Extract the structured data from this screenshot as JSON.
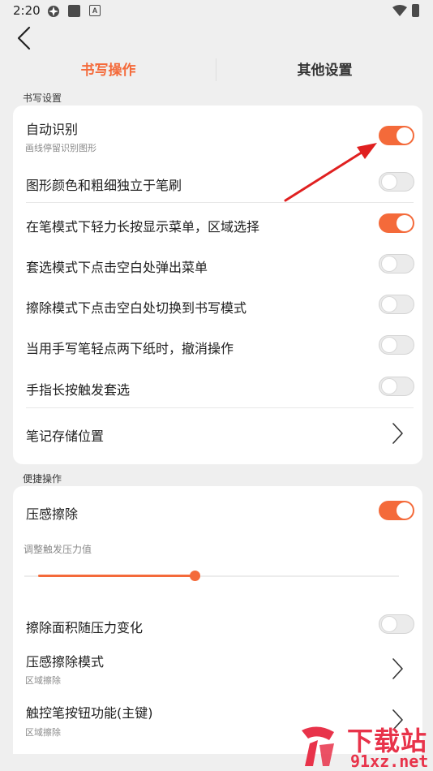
{
  "status_bar": {
    "time": "2:20"
  },
  "tabs": [
    {
      "label": "书写操作",
      "active": true
    },
    {
      "label": "其他设置",
      "active": false
    }
  ],
  "section_writing": {
    "title": "书写设置",
    "items": [
      {
        "label": "自动识别",
        "sub": "画线停留识别图形",
        "toggle": true
      },
      {
        "label": "图形颜色和粗细独立于笔刷",
        "toggle": false
      },
      {
        "label": "在笔模式下轻力长按显示菜单，区域选择",
        "toggle": true
      },
      {
        "label": "套选模式下点击空白处弹出菜单",
        "toggle": false
      },
      {
        "label": "擦除模式下点击空白处切换到书写模式",
        "toggle": false
      },
      {
        "label": "当用手写笔轻点两下纸时，撤消操作",
        "toggle": false
      },
      {
        "label": "手指长按触发套选",
        "toggle": false
      },
      {
        "label": "笔记存储位置"
      }
    ]
  },
  "section_shortcut": {
    "title": "便捷操作",
    "pressure_erase": {
      "label": "压感擦除",
      "toggle": true
    },
    "pressure_threshold": {
      "label": "调整触发压力值",
      "value_fraction": 0.45
    },
    "erase_area": {
      "label": "擦除面积随压力变化",
      "toggle": false
    },
    "erase_mode": {
      "label": "压感擦除模式",
      "sub": "区域擦除"
    },
    "pen_button": {
      "label": "触控笔按钮功能(主键)",
      "sub": "区域擦除"
    }
  },
  "watermark": {
    "text1": "下载站",
    "text2": "91xz.net"
  },
  "colors": {
    "accent": "#f46a3a",
    "arrow": "#e02020"
  }
}
